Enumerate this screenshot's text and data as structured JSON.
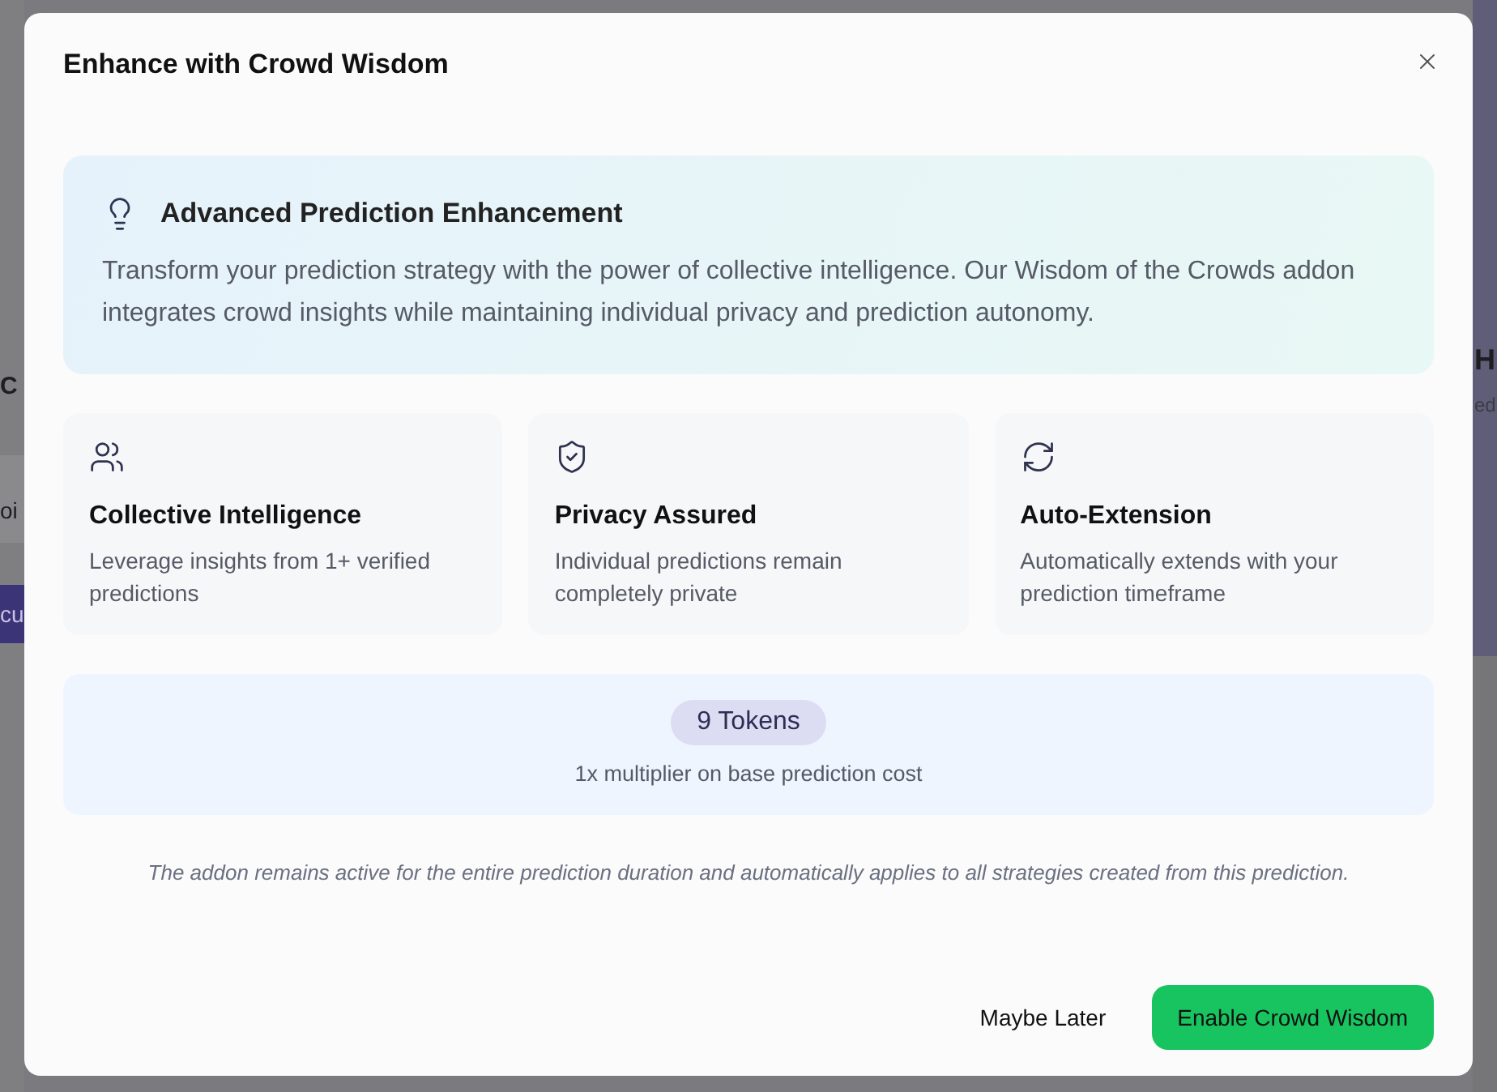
{
  "backdrop": {
    "left": [
      {
        "kind": "heading",
        "text": "C"
      },
      {
        "kind": "field",
        "text": "oi"
      },
      {
        "kind": "button",
        "text": "cu"
      }
    ],
    "right": [
      {
        "kind": "heading",
        "text": "H"
      },
      {
        "kind": "text",
        "text": "ed"
      }
    ]
  },
  "dialog": {
    "title": "Enhance with Crowd Wisdom",
    "intro": {
      "title": "Advanced Prediction Enhancement",
      "text": "Transform your prediction strategy with the power of collective intelligence. Our Wisdom of the Crowds addon integrates crowd insights while maintaining individual privacy and prediction autonomy."
    },
    "features": [
      {
        "kind": "people",
        "title": "Collective Intelligence",
        "text": "Leverage insights from 1+ verified predictions"
      },
      {
        "kind": "shield",
        "title": "Privacy Assured",
        "text": "Individual predictions remain completely private"
      },
      {
        "kind": "refresh",
        "title": "Auto-Extension",
        "text": "Automatically extends with your prediction timeframe"
      }
    ],
    "cost": {
      "tokens": "9 Tokens",
      "note": "1x multiplier on base prediction cost"
    },
    "footnote": "The addon remains active for the entire prediction duration and automatically applies to all strategies created from this prediction.",
    "buttons": [
      {
        "kind": "secondary",
        "label": "Maybe Later"
      },
      {
        "kind": "primary",
        "label": "Enable Crowd Wisdom"
      }
    ]
  }
}
